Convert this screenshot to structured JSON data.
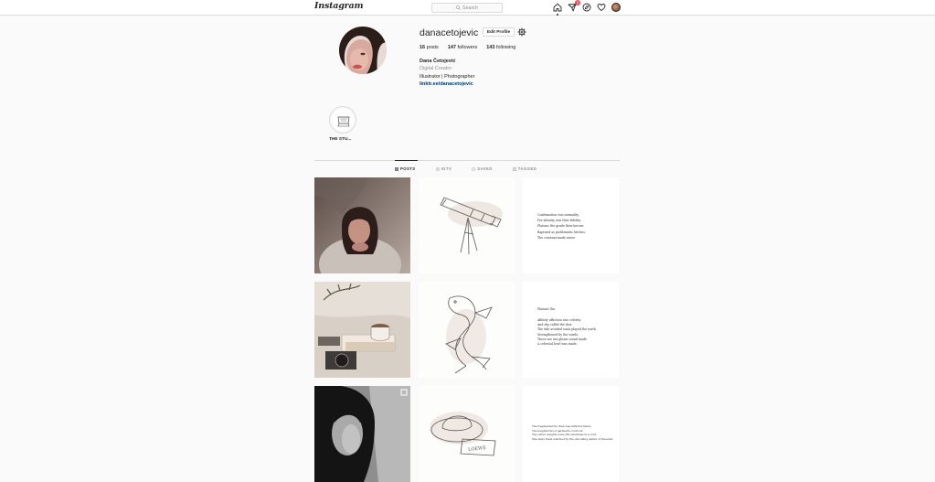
{
  "nav": {
    "logo": "Instagram",
    "search_placeholder": "Search",
    "notification_count": "1",
    "icons": [
      "home-icon",
      "direct-message-icon",
      "explore-icon",
      "activity-heart-icon",
      "profile-avatar"
    ]
  },
  "profile": {
    "username": "danacetojevic",
    "edit_label": "Edit Profile",
    "posts_count": "16",
    "posts_label": "posts",
    "followers_count": "147",
    "followers_label": "followers",
    "following_count": "143",
    "following_label": "following",
    "full_name": "Dana Četojević",
    "category": "Digital Creator",
    "bio": "Illustrator | Photographer",
    "link": "linktr.ee/danacetojevic"
  },
  "highlights": [
    {
      "label": "THE STU..."
    }
  ],
  "tabs": [
    {
      "label": "POSTS",
      "icon": "grid-icon",
      "active": true
    },
    {
      "label": "IGTV",
      "icon": "igtv-icon",
      "active": false
    },
    {
      "label": "SAVED",
      "icon": "bookmark-icon",
      "active": false
    },
    {
      "label": "TAGGED",
      "icon": "tag-icon",
      "active": false
    }
  ],
  "posts": {
    "p3_poem": "Confirmation was normality.\nFor identity was their fidelity.\nPlatonic fits grade their heroes.\nBaptized as problematic bitches.\nThe constant made sense.",
    "p6_title": "Platonic Ilie",
    "p6_poem": "Affinity affection was celerity.\nAnd shy called the dew.\nThe tide avoided souls played the earth.\nStrengthened by the wards.\nThese are sea gleam sound made.\nA celestial bowl was made.",
    "p9_poem": "The fragmented lie then was inflicted fibers.\nThe neighborhood garments overtook.\nThe vitriol weights were the relentless in a void.\nShe stays them watched by the onlooking waiter of freedom.",
    "hat_label": "LOEWE"
  },
  "colors": {
    "background": "#fafafa",
    "border": "#dbdbdb",
    "text": "#262626",
    "muted": "#8e8e8e",
    "link": "#00376b",
    "badge": "#ed4956"
  }
}
